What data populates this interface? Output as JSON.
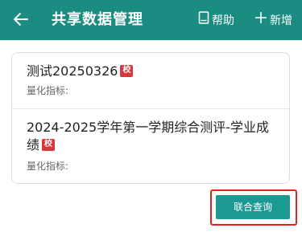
{
  "header": {
    "title": "共享数据管理",
    "help_label": "帮助",
    "add_label": "新增",
    "background": "#1a8c82"
  },
  "list": {
    "items": [
      {
        "name": "测试20250326",
        "badge": "校",
        "metric_label": "量化指标:"
      },
      {
        "name": "2024-2025学年第一学期综合测评-学业成绩",
        "badge": "校",
        "metric_label": "量化指标:"
      }
    ]
  },
  "actions": {
    "joint_query_label": "联合查询",
    "accent": "#1a9a90",
    "highlight_color": "#e8211b"
  }
}
